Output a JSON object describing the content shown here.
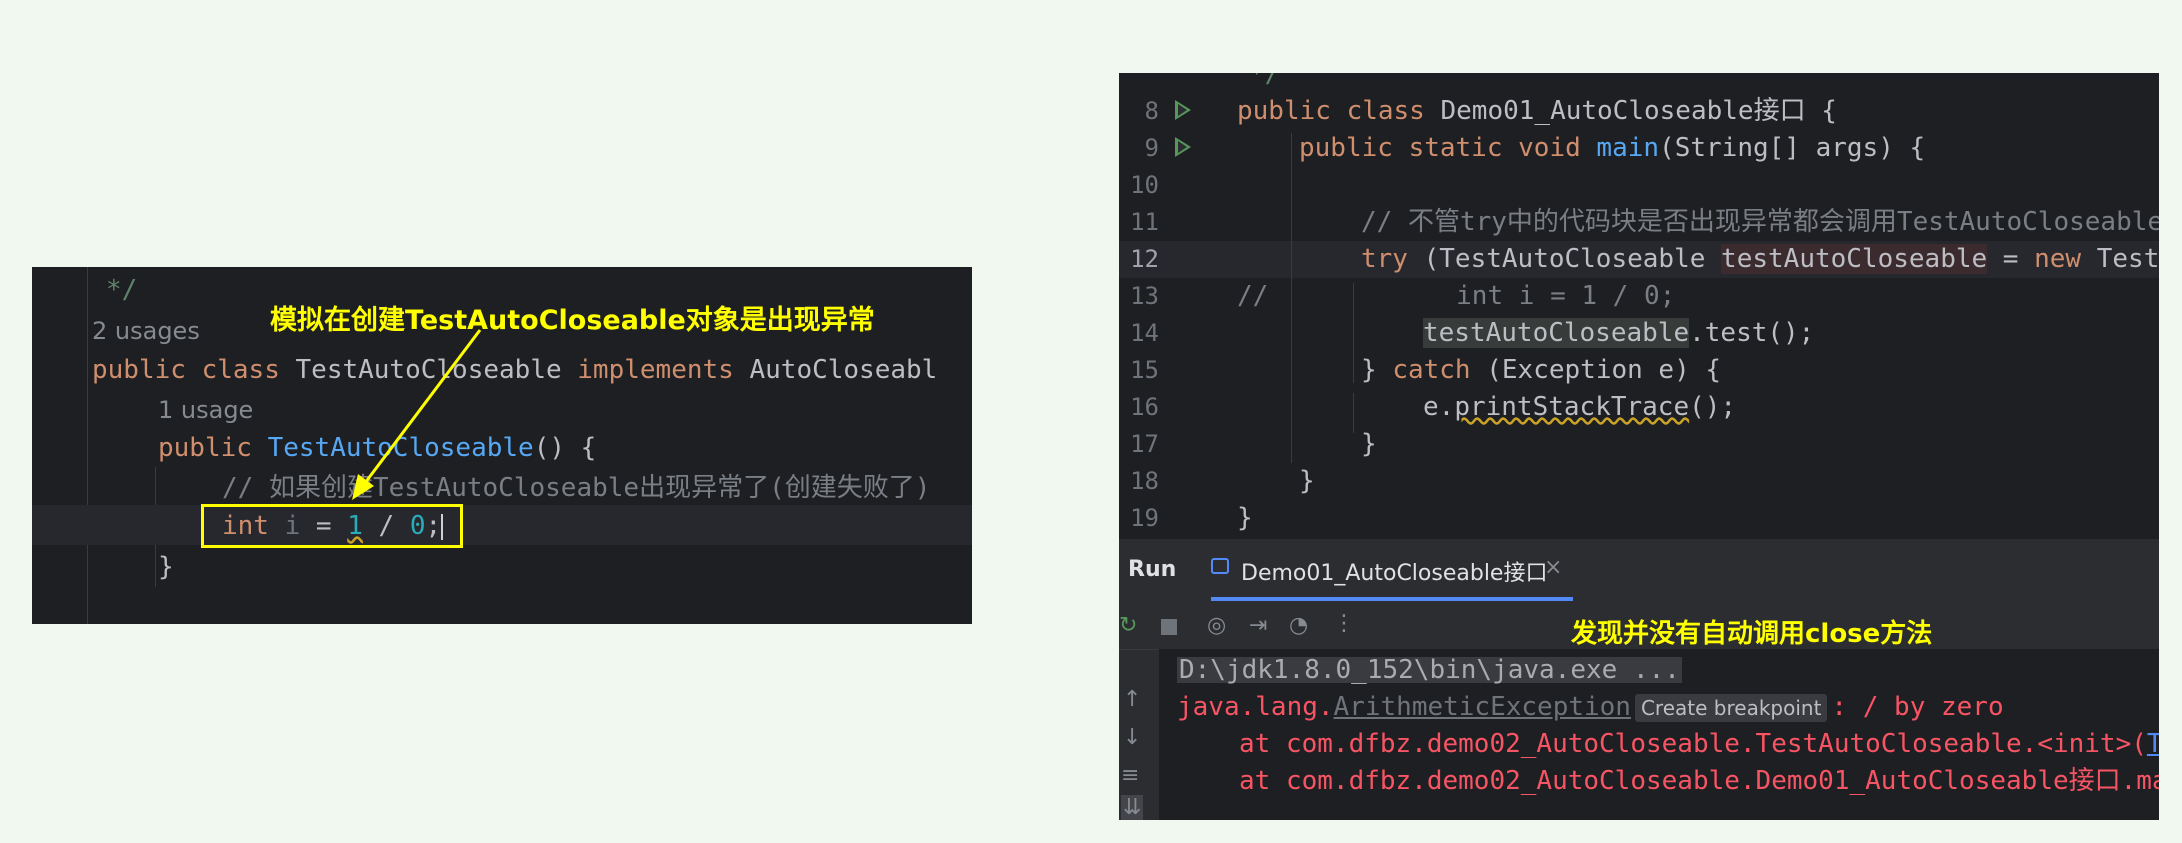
{
  "left": {
    "comment_end": "*/",
    "class_usages": "2 usages",
    "class_decl": {
      "kw1": "public",
      "kw2": "class",
      "name": "TestAutoCloseable",
      "kw3": "implements",
      "iface": "AutoCloseabl"
    },
    "ctor_usages": "1 usage",
    "ctor_decl": {
      "kw": "public",
      "name": "TestAutoCloseable",
      "rest": "() {"
    },
    "comment": "// 如果创建TestAutoCloseable出现异常了(创建失败了)",
    "code_line": {
      "kw": "int",
      "var": "i",
      "eq": " = ",
      "n1": "1",
      "op": " / ",
      "n2": "0",
      "end": ";"
    },
    "close_brace": "}",
    "annotation": "模拟在创建TestAutoCloseable对象是出现异常"
  },
  "right": {
    "lines": [
      {
        "num": "8",
        "run": true
      },
      {
        "num": "9",
        "run": true
      },
      {
        "num": "10"
      },
      {
        "num": "11"
      },
      {
        "num": "12"
      },
      {
        "num": "13"
      },
      {
        "num": "14"
      },
      {
        "num": "15"
      },
      {
        "num": "16"
      },
      {
        "num": "17"
      },
      {
        "num": "18"
      },
      {
        "num": "19"
      }
    ],
    "code": {
      "l7": "*/",
      "l8_kw": "public class ",
      "l8_name": "Demo01_AutoCloseable接口",
      "l8_rest": " {",
      "l9_kw": "public static void ",
      "l9_fn": "main",
      "l9_rest": "(String[] args) {",
      "l11": "// 不管try中的代码块是否出现异常都会调用TestAutoCloseable",
      "l12_kw": "try",
      "l12_a": " (TestAutoCloseable ",
      "l12_var": "testAutoCloseable",
      "l12_b": " = ",
      "l12_new": "new",
      "l12_c": " TestA",
      "l13": "//            int i = 1 / 0;",
      "l14_var": "testAutoCloseable",
      "l14_rest": ".test();",
      "l15_a": "} ",
      "l15_kw": "catch",
      "l15_b": " (Exception e) {",
      "l16_a": "e.",
      "l16_fn": "printStackTrace",
      "l16_b": "();",
      "l17": "}",
      "l18": "}",
      "l19": "}"
    },
    "run_panel": {
      "label": "Run",
      "tab": "Demo01_AutoCloseable接口",
      "close": "×",
      "annotation": "发现并没有自动调用close方法",
      "console": {
        "cmd": "D:\\jdk1.8.0_152\\bin\\java.exe ...",
        "exc_prefix": "java.lang.",
        "exc_name": "ArithmeticException",
        "breakpoint": "Create breakpoint",
        "exc_msg": ": / by zero",
        "at1": "at com.dfbz.demo02_AutoCloseable.TestAutoCloseable.<init>(",
        "at1_link": "Te",
        "at2": "at com.dfbz.demo02_AutoCloseable.Demo01_AutoCloseable接口.ma"
      }
    }
  },
  "colors": {
    "bg": "#f1f8ef",
    "editor_bg": "#1e1f22",
    "keyword": "#cf8e6d",
    "function": "#56a8f5",
    "annotation": "#ffff00",
    "error": "#f75464"
  }
}
